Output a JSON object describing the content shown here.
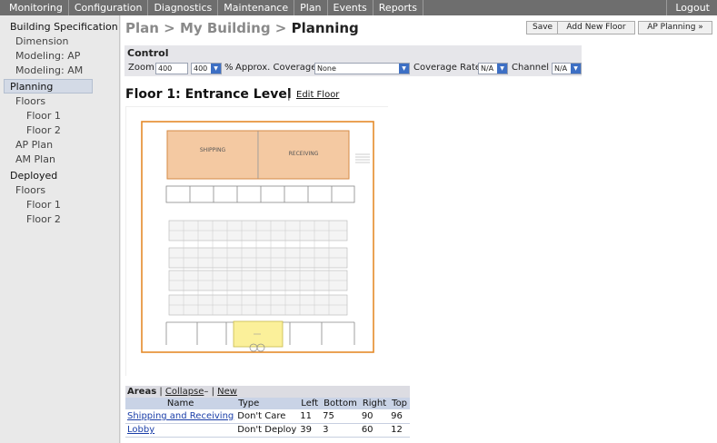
{
  "topnav": {
    "tabs": [
      "Monitoring",
      "Configuration",
      "Diagnostics",
      "Maintenance",
      "Plan",
      "Events",
      "Reports"
    ],
    "logout": "Logout"
  },
  "sidebar": {
    "items": [
      {
        "label": "Building Specification"
      },
      {
        "label": "Dimension"
      },
      {
        "label": "Modeling: AP"
      },
      {
        "label": "Modeling: AM"
      },
      {
        "label": "Planning"
      },
      {
        "label": "Floors"
      },
      {
        "label": "Floor 1"
      },
      {
        "label": "Floor 2"
      },
      {
        "label": "AP Plan"
      },
      {
        "label": "AM Plan"
      },
      {
        "label": "Deployed"
      },
      {
        "label": "Floors"
      },
      {
        "label": "Floor 1"
      },
      {
        "label": "Floor 2"
      }
    ]
  },
  "header": {
    "crumb_prefix": "Plan > My Building > ",
    "crumb_current": "Planning",
    "buttons": {
      "save": "Save",
      "add_floor": "Add New Floor",
      "ap_planning": "AP Planning »"
    }
  },
  "control": {
    "title": "Control",
    "zoom_label": "Zoom",
    "zoom_value": "400",
    "zoom_select": "400",
    "percent": "%",
    "coverage_label": "Approx. Coverage",
    "coverage_value": "None",
    "rate_label": "Coverage Rate",
    "rate_value": "N/A",
    "channel_label": "Channel",
    "channel_value": "N/A"
  },
  "floor": {
    "title": "Floor 1: Entrance Level",
    "separator": "|",
    "edit": "Edit Floor",
    "rooms": {
      "shipping": "SHIPPING",
      "receiving": "RECEIVING"
    }
  },
  "areas": {
    "title": "Areas",
    "collapse": "Collapse",
    "collapse_icon": "–",
    "sep": "|",
    "new": "New",
    "columns": [
      "Name",
      "Type",
      "Left",
      "Bottom",
      "Right",
      "Top"
    ],
    "rows": [
      [
        "Shipping and Receiving",
        "Don't Care",
        "11",
        "75",
        "90",
        "96"
      ],
      [
        "Lobby",
        "Don't Deploy",
        "39",
        "3",
        "60",
        "12"
      ]
    ]
  },
  "colors": {
    "nav": "#6e6e6e",
    "accent": "#3d6fc4",
    "shipping": "#f4c9a2",
    "lobby": "#fbf09a",
    "wall": "#e58a2a"
  }
}
